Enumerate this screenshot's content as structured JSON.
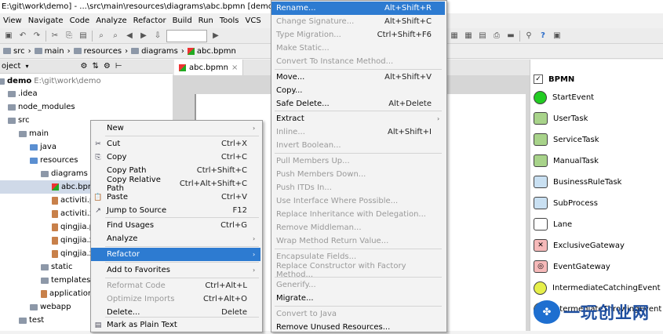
{
  "window": {
    "title": "E:\\git\\work\\demo] - ...\\src\\main\\resources\\diagrams\\abc.bpmn [demo] -"
  },
  "menubar": [
    "View",
    "Navigate",
    "Code",
    "Analyze",
    "Refactor",
    "Build",
    "Run",
    "Tools",
    "VCS"
  ],
  "breadcrumb": [
    "src",
    "main",
    "resources",
    "diagrams",
    "abc.bpmn"
  ],
  "project_panel": {
    "title": "oject"
  },
  "tree": [
    {
      "label": "demo",
      "extra": "E:\\git\\work\\demo",
      "indent": 0
    },
    {
      "label": ".idea",
      "indent": 1
    },
    {
      "label": "node_modules",
      "indent": 1
    },
    {
      "label": "src",
      "indent": 1
    },
    {
      "label": "main",
      "indent": 2
    },
    {
      "label": "java",
      "indent": 3
    },
    {
      "label": "resources",
      "indent": 3
    },
    {
      "label": "diagrams",
      "indent": 4
    },
    {
      "label": "abc.bpmn",
      "indent": 5,
      "selected": true
    },
    {
      "label": "activiti.p",
      "indent": 5
    },
    {
      "label": "activiti.x",
      "indent": 5
    },
    {
      "label": "qingjia.p",
      "indent": 5
    },
    {
      "label": "qingjia.x",
      "indent": 5
    },
    {
      "label": "qingjia.x",
      "indent": 5
    },
    {
      "label": "static",
      "indent": 4
    },
    {
      "label": "templates",
      "indent": 4
    },
    {
      "label": "application.",
      "indent": 4
    },
    {
      "label": "webapp",
      "indent": 3
    },
    {
      "label": "test",
      "indent": 2
    }
  ],
  "editor": {
    "tab": "abc.bpmn"
  },
  "palette": {
    "header": "BPMN",
    "items": [
      "StartEvent",
      "UserTask",
      "ServiceTask",
      "ManualTask",
      "BusinessRuleTask",
      "SubProcess",
      "Lane",
      "ExclusiveGateway",
      "EventGateway",
      "IntermediateCatchingEvent",
      "IntermediateThrowingEvent"
    ]
  },
  "context_menu": [
    {
      "label": "New",
      "shortcut": "",
      "submenu": true
    },
    {
      "label": "Cut",
      "shortcut": "Ctrl+X",
      "icon": "✂"
    },
    {
      "label": "Copy",
      "shortcut": "Ctrl+C",
      "icon": "⎘"
    },
    {
      "label": "Copy Path",
      "shortcut": "Ctrl+Shift+C"
    },
    {
      "label": "Copy Relative Path",
      "shortcut": "Ctrl+Alt+Shift+C"
    },
    {
      "label": "Paste",
      "shortcut": "Ctrl+V",
      "icon": "📋"
    },
    {
      "label": "Jump to Source",
      "shortcut": "F12",
      "icon": "↗"
    },
    {
      "label": "Find Usages",
      "shortcut": "Ctrl+G"
    },
    {
      "label": "Analyze",
      "shortcut": "",
      "submenu": true
    },
    {
      "label": "Refactor",
      "shortcut": "",
      "submenu": true,
      "highlighted": true
    },
    {
      "label": "Add to Favorites",
      "shortcut": "",
      "submenu": true
    },
    {
      "label": "Reformat Code",
      "shortcut": "Ctrl+Alt+L",
      "disabled": true
    },
    {
      "label": "Optimize Imports",
      "shortcut": "Ctrl+Alt+O",
      "disabled": true
    },
    {
      "label": "Delete...",
      "shortcut": "Delete"
    },
    {
      "label": "Mark as Plain Text",
      "shortcut": "",
      "icon": "▤"
    }
  ],
  "refactor_menu": [
    {
      "label": "Rename...",
      "shortcut": "Alt+Shift+R",
      "highlighted": true
    },
    {
      "label": "Change Signature...",
      "shortcut": "Alt+Shift+C",
      "disabled": true
    },
    {
      "label": "Type Migration...",
      "shortcut": "Ctrl+Shift+F6",
      "disabled": true
    },
    {
      "label": "Make Static...",
      "shortcut": "",
      "disabled": true
    },
    {
      "label": "Convert To Instance Method...",
      "shortcut": "",
      "disabled": true
    },
    {
      "label": "Move...",
      "shortcut": "Alt+Shift+V"
    },
    {
      "label": "Copy...",
      "shortcut": ""
    },
    {
      "label": "Safe Delete...",
      "shortcut": "Alt+Delete"
    },
    {
      "label": "Extract",
      "shortcut": "",
      "submenu": true
    },
    {
      "label": "Inline...",
      "shortcut": "Alt+Shift+I",
      "disabled": true
    },
    {
      "label": "Invert Boolean...",
      "shortcut": "",
      "disabled": true
    },
    {
      "label": "Pull Members Up...",
      "shortcut": "",
      "disabled": true
    },
    {
      "label": "Push Members Down...",
      "shortcut": "",
      "disabled": true
    },
    {
      "label": "Push ITDs In...",
      "shortcut": "",
      "disabled": true
    },
    {
      "label": "Use Interface Where Possible...",
      "shortcut": "",
      "disabled": true
    },
    {
      "label": "Replace Inheritance with Delegation...",
      "shortcut": "",
      "disabled": true
    },
    {
      "label": "Remove Middleman...",
      "shortcut": "",
      "disabled": true
    },
    {
      "label": "Wrap Method Return Value...",
      "shortcut": "",
      "disabled": true
    },
    {
      "label": "Encapsulate Fields...",
      "shortcut": "",
      "disabled": true
    },
    {
      "label": "Replace Constructor with Factory Method...",
      "shortcut": "",
      "disabled": true
    },
    {
      "label": "Generify...",
      "shortcut": "",
      "disabled": true
    },
    {
      "label": "Migrate...",
      "shortcut": ""
    },
    {
      "label": "Convert to Java",
      "shortcut": "",
      "disabled": true
    },
    {
      "label": "Remove Unused Resources...",
      "shortcut": ""
    }
  ],
  "watermark": {
    "text": "一玩创业网"
  },
  "colors": {
    "highlight": "#2d7bd1",
    "start_event": "#22cc22",
    "watermark": "#1f4fa0"
  }
}
